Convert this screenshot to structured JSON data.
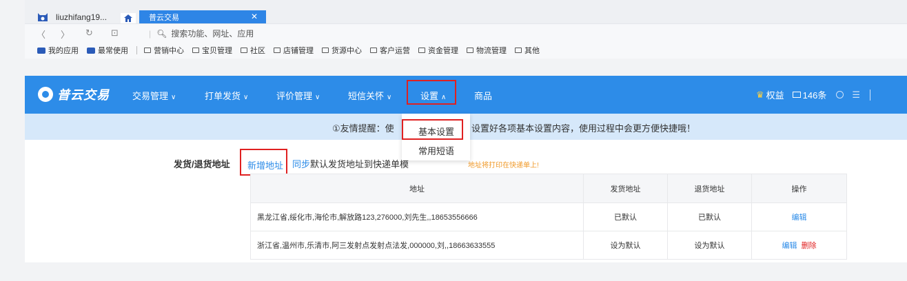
{
  "browser": {
    "tabs": [
      {
        "label": "liuzhifang19..."
      },
      {
        "label": "普云交易"
      }
    ],
    "address_placeholder": "搜索功能、网址、应用",
    "bookmarks": [
      "我的应用",
      "最常使用",
      "营销中心",
      "宝贝管理",
      "社区",
      "店铺管理",
      "货源中心",
      "客户运营",
      "资金管理",
      "物流管理",
      "其他"
    ]
  },
  "app": {
    "brand": "普云交易",
    "menu": [
      {
        "label": "交易管理"
      },
      {
        "label": "打单发货"
      },
      {
        "label": "评价管理"
      },
      {
        "label": "短信关怀"
      },
      {
        "label": "设置"
      },
      {
        "label": "商品"
      }
    ],
    "right": {
      "rights": "权益",
      "sms_count": "146条"
    }
  },
  "notice": {
    "left": "①友情提醒：使",
    "right": "设置好各项基本设置内容，使用过程中会更方便快捷哦！"
  },
  "dropdown": [
    "基本设置",
    "常用短语"
  ],
  "address_section": {
    "label": "发货/退货地址",
    "add_link": "新增地址",
    "sync_link": "同步",
    "sync_text": "默认发货地址到快递单模",
    "tip": "地址将打印在快递单上!",
    "columns": [
      "地址",
      "发货地址",
      "退货地址",
      "操作"
    ],
    "rows": [
      {
        "address": "黑龙江省,绥化市,海伦市,解放路123,276000,刘先生,,18653556666",
        "ship": "已默认",
        "return": "已默认",
        "ops": [
          "编辑"
        ]
      },
      {
        "address": "浙江省,温州市,乐清市,阿三发射点发射点法发,000000,刘,,18663633555",
        "ship": "设为默认",
        "return": "设为默认",
        "ops": [
          "编辑",
          "删除"
        ]
      }
    ]
  }
}
